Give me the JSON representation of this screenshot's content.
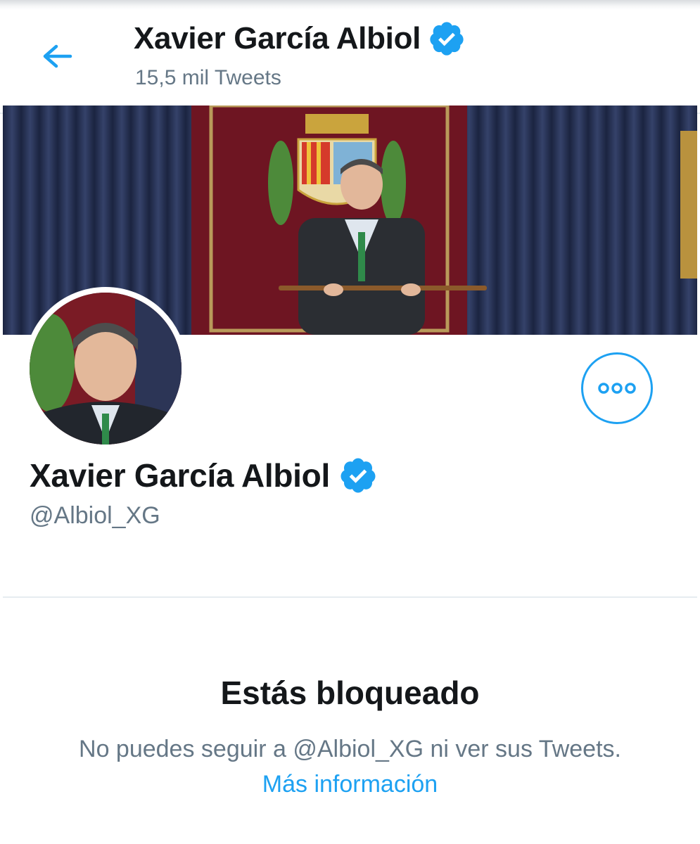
{
  "header": {
    "title": "Xavier García Albiol",
    "subtitle": "15,5 mil Tweets",
    "back_icon": "arrow-left-icon",
    "verified_icon": "verified-badge-icon"
  },
  "profile": {
    "name": "Xavier García Albiol",
    "handle": "@Albiol_XG",
    "verified_icon": "verified-badge-icon",
    "more_icon": "more-options-icon"
  },
  "blocked": {
    "title": "Estás bloqueado",
    "message": "No puedes seguir a @Albiol_XG ni ver sus Tweets.",
    "link": "Más información"
  },
  "colors": {
    "accent": "#1da1f2",
    "text_primary": "#14171a",
    "text_secondary": "#657786",
    "divider": "#e6ecf0"
  }
}
